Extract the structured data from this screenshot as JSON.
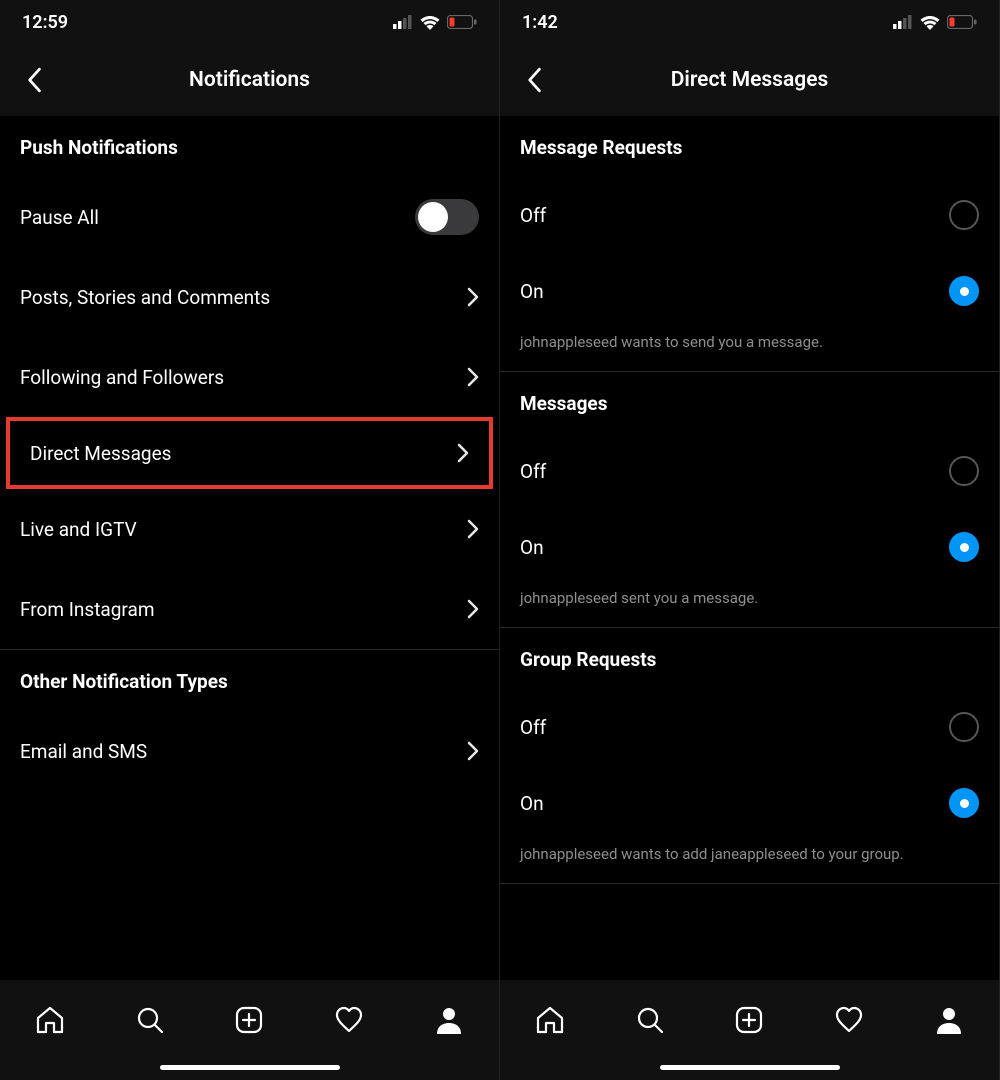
{
  "left": {
    "status_time": "12:59",
    "header_title": "Notifications",
    "section1": "Push Notifications",
    "pause_all": "Pause All",
    "items": [
      "Posts, Stories and Comments",
      "Following and Followers",
      "Direct Messages",
      "Live and IGTV",
      "From Instagram"
    ],
    "section2": "Other Notification Types",
    "email_sms": "Email and SMS"
  },
  "right": {
    "status_time": "1:42",
    "header_title": "Direct Messages",
    "groups": [
      {
        "title": "Message Requests",
        "off": "Off",
        "on": "On",
        "selected": "on",
        "hint": "johnappleseed wants to send you a message."
      },
      {
        "title": "Messages",
        "off": "Off",
        "on": "On",
        "selected": "on",
        "hint": "johnappleseed sent you a message."
      },
      {
        "title": "Group Requests",
        "off": "Off",
        "on": "On",
        "selected": "on",
        "hint": "johnappleseed wants to add janeappleseed to your group."
      }
    ]
  }
}
